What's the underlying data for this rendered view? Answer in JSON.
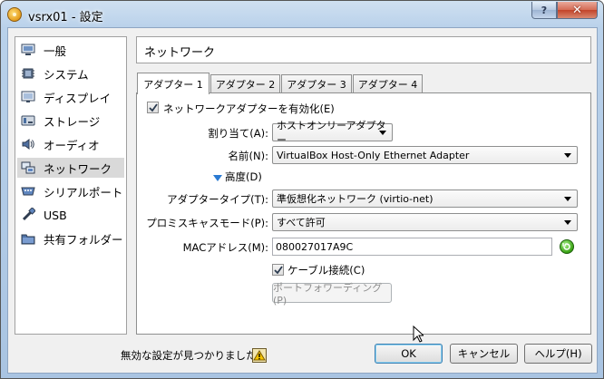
{
  "window": {
    "title": "vsrx01 - 設定",
    "help_button": "?",
    "close_button": "✕"
  },
  "sidebar": {
    "items": [
      {
        "label": "一般",
        "icon": "monitor-icon"
      },
      {
        "label": "システム",
        "icon": "chip-icon"
      },
      {
        "label": "ディスプレイ",
        "icon": "display-icon"
      },
      {
        "label": "ストレージ",
        "icon": "storage-icon"
      },
      {
        "label": "オーディオ",
        "icon": "speaker-icon"
      },
      {
        "label": "ネットワーク",
        "icon": "network-icon",
        "selected": true
      },
      {
        "label": "シリアルポート",
        "icon": "serial-port-icon"
      },
      {
        "label": "USB",
        "icon": "usb-icon"
      },
      {
        "label": "共有フォルダー",
        "icon": "folder-icon"
      }
    ]
  },
  "section_title": "ネットワーク",
  "tabs": [
    {
      "label": "アダプター 1",
      "active": true
    },
    {
      "label": "アダプター 2"
    },
    {
      "label": "アダプター 3"
    },
    {
      "label": "アダプター 4"
    }
  ],
  "adapter": {
    "enable_label": "ネットワークアダプターを有効化(E)",
    "enable_checked": true,
    "attached_label": "割り当て(A):",
    "attached_value": "ホストオンリーアダプター",
    "name_label": "名前(N):",
    "name_value": "VirtualBox Host-Only Ethernet Adapter",
    "advanced_label": "高度(D)",
    "adapter_type_label": "アダプタータイプ(T):",
    "adapter_type_value": "準仮想化ネットワーク (virtio-net)",
    "promisc_label": "プロミスキャスモード(P):",
    "promisc_value": "すべて許可",
    "mac_label": "MACアドレス(M):",
    "mac_value": "080027017A9C",
    "cable_label": "ケーブル接続(C)",
    "cable_checked": true,
    "port_forward_label": "ポートフォワーディング(P)"
  },
  "footer": {
    "status_text": "無効な設定が見つかりました",
    "ok_label": "OK",
    "cancel_label": "キャンセル",
    "help_label": "ヘルプ(H)"
  },
  "colors": {
    "accent_blue": "#2a7ad2",
    "selected_bg": "#d9d9d9",
    "window_frame": "#b9d1ea"
  }
}
